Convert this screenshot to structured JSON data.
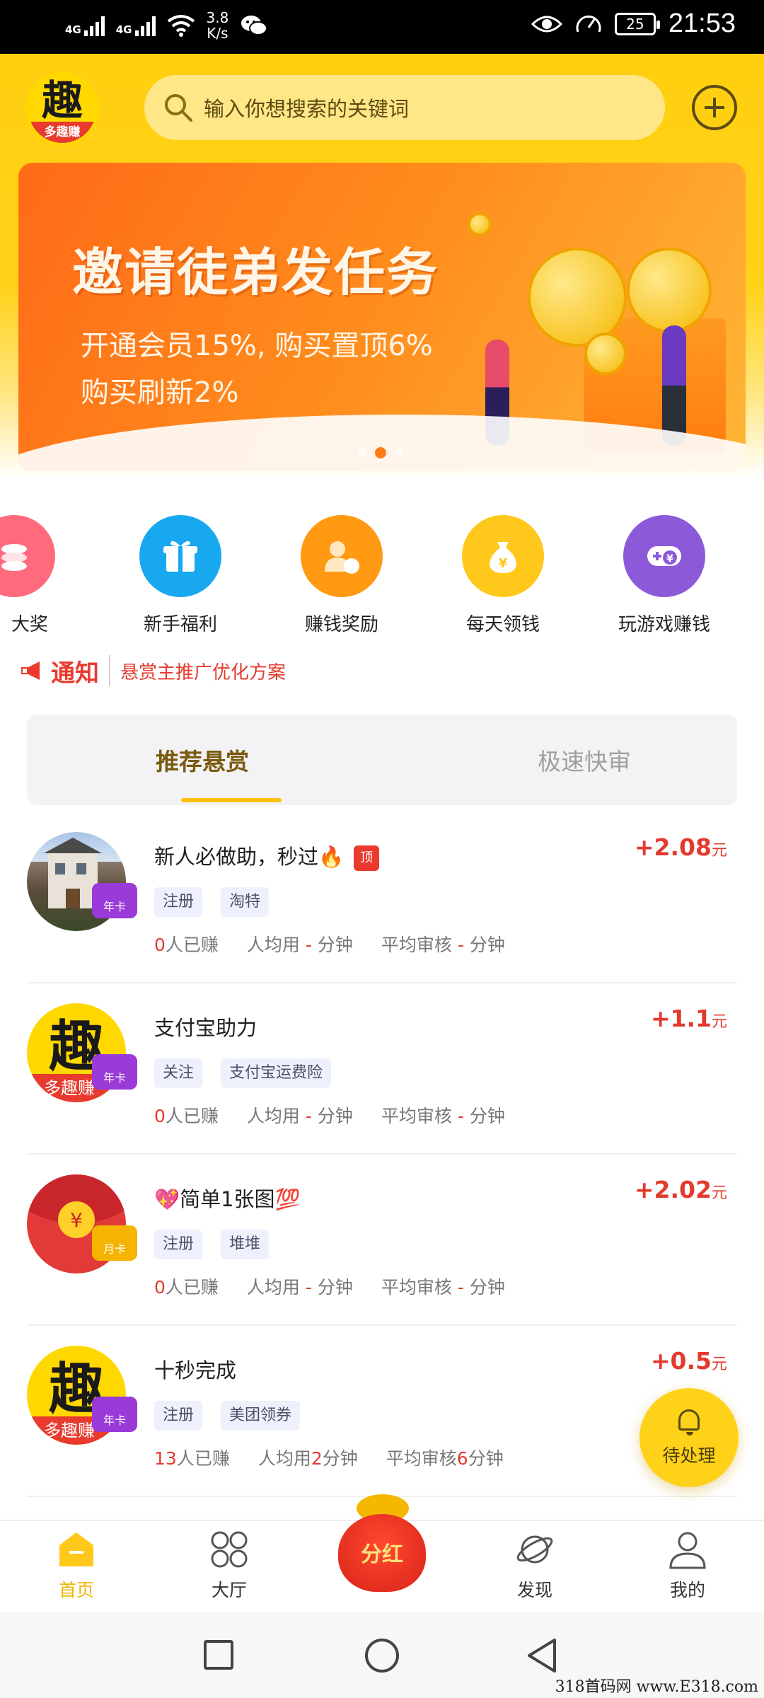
{
  "status_bar": {
    "net1": "4G",
    "net2": "4G",
    "speed_value": "3.8",
    "speed_unit": "K/s",
    "battery": "25",
    "time": "21:53"
  },
  "header": {
    "logo_char": "趣",
    "logo_text": "多趣赚",
    "search_placeholder": "输入你想搜索的关键词"
  },
  "banner": {
    "title": "邀请徒弟发任务",
    "line1": "开通会员15%, 购买置顶6%",
    "line2": "购买刷新2%",
    "dots": 3,
    "active_dot": 1
  },
  "shortcuts": [
    {
      "label": "大奖",
      "color": "#ff6b7d",
      "icon": "coins-icon"
    },
    {
      "label": "新手福利",
      "color": "#18a8f0",
      "icon": "gift-icon"
    },
    {
      "label": "赚钱奖励",
      "color": "#ff9a12",
      "icon": "money-bag-user-icon"
    },
    {
      "label": "每天领钱",
      "color": "#ffc81a",
      "icon": "money-bag-icon"
    },
    {
      "label": "玩游戏赚钱",
      "color": "#8c5ad8",
      "icon": "gamepad-icon"
    }
  ],
  "notice": {
    "tag": "通知",
    "text": "悬赏主推广优化方案"
  },
  "tabs": {
    "active": "推荐悬赏",
    "inactive": "极速快审"
  },
  "tasks": [
    {
      "title": "新人必做助，秒过🔥",
      "top_tag": "顶",
      "badge": "年卡",
      "tags": [
        "注册",
        "淘特"
      ],
      "earned_count": "0",
      "earned_suffix": "人已赚",
      "avg_prefix": "人均用",
      "avg_value": "-",
      "avg_unit": "分钟",
      "review_prefix": "平均审核",
      "review_value": "-",
      "review_unit": "分钟",
      "reward": "+2.08",
      "unit": "元"
    },
    {
      "title": "支付宝助力",
      "top_tag": "",
      "badge": "年卡",
      "tags": [
        "关注",
        "支付宝运费险"
      ],
      "earned_count": "0",
      "earned_suffix": "人已赚",
      "avg_prefix": "人均用",
      "avg_value": "-",
      "avg_unit": "分钟",
      "review_prefix": "平均审核",
      "review_value": "-",
      "review_unit": "分钟",
      "reward": "+1.1",
      "unit": "元"
    },
    {
      "title": "💖简单1张图💯",
      "top_tag": "",
      "badge": "月卡",
      "tags": [
        "注册",
        "堆堆"
      ],
      "earned_count": "0",
      "earned_suffix": "人已赚",
      "avg_prefix": "人均用",
      "avg_value": "-",
      "avg_unit": "分钟",
      "review_prefix": "平均审核",
      "review_value": "-",
      "review_unit": "分钟",
      "reward": "+2.02",
      "unit": "元"
    },
    {
      "title": "十秒完成",
      "top_tag": "",
      "badge": "年卡",
      "tags": [
        "注册",
        "美团领券"
      ],
      "earned_count": "13",
      "earned_suffix": "人已赚",
      "avg_prefix": "人均用",
      "avg_value": "2",
      "avg_unit": "分钟",
      "review_prefix": "平均审核",
      "review_value": "6",
      "review_unit": "分钟",
      "reward": "+0.5",
      "unit": "元"
    }
  ],
  "pending": {
    "label": "待处理"
  },
  "bottom_nav": {
    "home": "首页",
    "hall": "大厅",
    "center": "分红",
    "discover": "发现",
    "mine": "我的"
  },
  "watermark": "318首码网 www.E318.com",
  "colors": {
    "brand_yellow": "#ffd21a",
    "accent_red": "#e33a2f",
    "tab_text": "#7a5a0f"
  }
}
